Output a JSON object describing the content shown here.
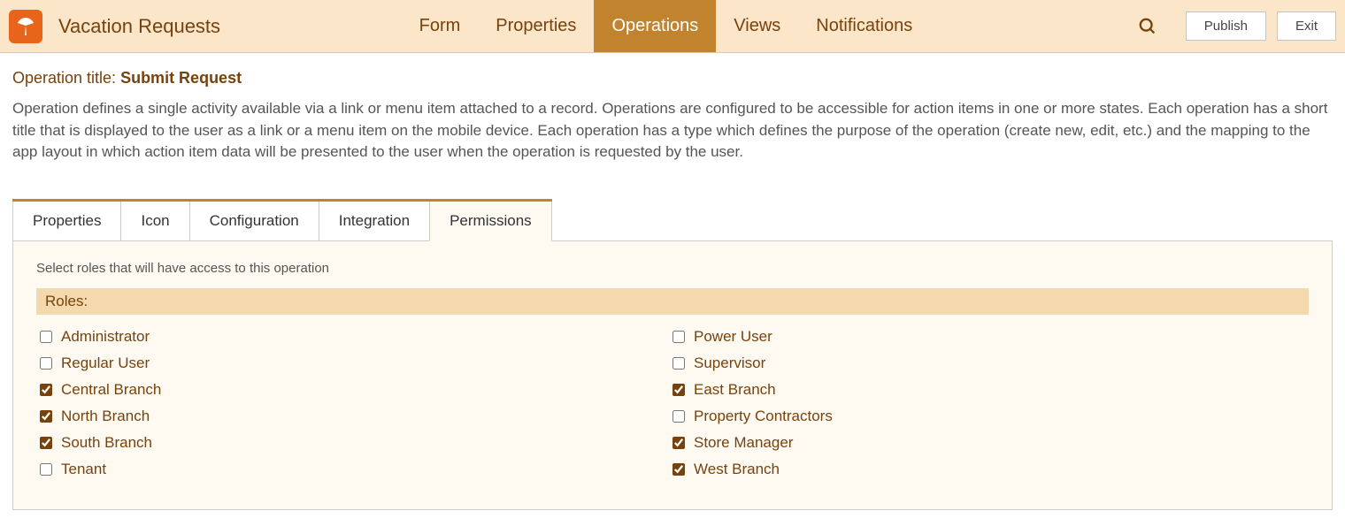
{
  "header": {
    "app_title": "Vacation Requests",
    "tabs": [
      {
        "label": "Form",
        "active": false
      },
      {
        "label": "Properties",
        "active": false
      },
      {
        "label": "Operations",
        "active": true
      },
      {
        "label": "Views",
        "active": false
      },
      {
        "label": "Notifications",
        "active": false
      }
    ],
    "publish_label": "Publish",
    "exit_label": "Exit"
  },
  "operation": {
    "title_prefix": "Operation title: ",
    "title_value": "Submit Request",
    "description": "Operation defines a single activity available via a link or menu item attached to a record. Operations are configured to be accessible for action items in one or more states. Each operation has a short title that is displayed to the user as a link or a menu item on the mobile device. Each operation has a type which defines the purpose of the operation (create new, edit, etc.) and the mapping to the app layout in which action item data will be presented to the user when the operation is requested by the user."
  },
  "subtabs": [
    {
      "label": "Properties",
      "active": false
    },
    {
      "label": "Icon",
      "active": false
    },
    {
      "label": "Configuration",
      "active": false
    },
    {
      "label": "Integration",
      "active": false
    },
    {
      "label": "Permissions",
      "active": true
    }
  ],
  "permissions": {
    "instruction": "Select roles that will have access to this operation",
    "roles_header": "Roles:",
    "roles_left": [
      {
        "label": "Administrator",
        "checked": false
      },
      {
        "label": "Regular User",
        "checked": false
      },
      {
        "label": "Central Branch",
        "checked": true
      },
      {
        "label": "North Branch",
        "checked": true
      },
      {
        "label": "South Branch",
        "checked": true
      },
      {
        "label": "Tenant",
        "checked": false
      }
    ],
    "roles_right": [
      {
        "label": "Power User",
        "checked": false
      },
      {
        "label": "Supervisor",
        "checked": false
      },
      {
        "label": "East Branch",
        "checked": true
      },
      {
        "label": "Property Contractors",
        "checked": false
      },
      {
        "label": "Store Manager",
        "checked": true
      },
      {
        "label": "West Branch",
        "checked": true
      }
    ]
  }
}
